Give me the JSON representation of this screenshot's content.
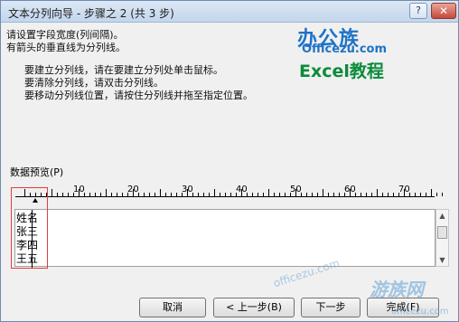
{
  "title": "文本分列向导 - 步骤之 2 (共 3 步)",
  "titlebar_buttons": {
    "help": "?",
    "close": "✕"
  },
  "instructions": {
    "line1": "请设置字段宽度(列间隔)。",
    "line2": "有箭头的垂直线为分列线。",
    "line3": "要建立分列线，请在要建立分列处单击鼠标。",
    "line4": "要清除分列线，请双击分列线。",
    "line5": "要移动分列线位置，请按住分列线并拖至指定位置。"
  },
  "branding": {
    "cn": "办公族",
    "domain": "Officezu.com",
    "excel": "Excel教程"
  },
  "preview": {
    "label": "数据预览(P)",
    "ruler_labels": [
      "10",
      "20",
      "30",
      "40",
      "50",
      "60",
      "70"
    ],
    "rows": [
      "姓名",
      "张三",
      "李四",
      "王五"
    ]
  },
  "buttons": {
    "cancel": "取消",
    "back": "< 上一步(B)",
    "next": "下一步",
    "finish": "完成(F)"
  },
  "watermark": {
    "site": "游族网",
    "domain": "officezu.com",
    "domain2": "officezu.com"
  }
}
